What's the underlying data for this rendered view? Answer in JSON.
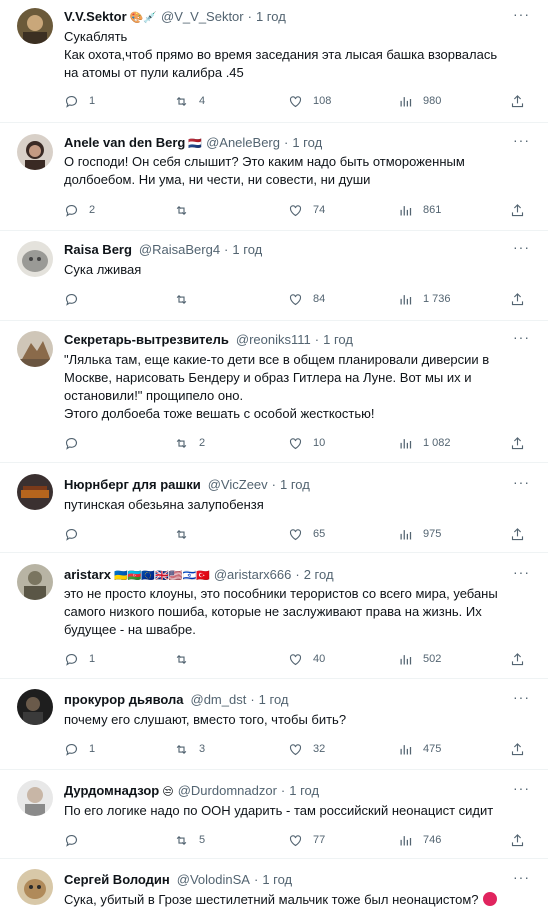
{
  "colors": {
    "text": "#0f1419",
    "secondary": "#536471",
    "divider": "#eff3f4"
  },
  "tweets": [
    {
      "name": "V.V.Sektor",
      "badges": "🎨💉",
      "handle": "@V_V_Sektor",
      "time": "1 год",
      "text": "Сукаблять\nКак охота,чтоб прямо во время заседания эта лысая башка взорвалась\nна  атомы от пули калибра .45",
      "replies": "1",
      "retweets": "4",
      "likes": "108",
      "views": "980",
      "avatar_color": "#6b5a3a"
    },
    {
      "name": "Anele van den Berg",
      "badges": "🇳🇱",
      "handle": "@AneleBerg",
      "time": "1 год",
      "text": "О господи! Он себя слышит? Это каким надо быть отмороженным\nдолбоебом. Ни ума, ни чести, ни совести, ни души",
      "replies": "2",
      "retweets": "",
      "likes": "74",
      "views": "861",
      "avatar_color": "#3a2a24"
    },
    {
      "name": "Raisa Berg",
      "badges": "",
      "handle": "@RaisaBerg4",
      "time": "1 год",
      "text": "Сука лживая",
      "replies": "",
      "retweets": "",
      "likes": "84",
      "views": "1 736",
      "avatar_color": "#9a9a96"
    },
    {
      "name": "Секретарь-вытрезвитель",
      "badges": "",
      "handle": "@reoniks111",
      "time": "1 год",
      "text": "\"Лялька там, еще какие-то дети все в общем планировали диверсии в\nМоскве, нарисовать Бендеру и образ Гитлера на Луне. Вот мы их и\nостановили!\" прощипело оно.\nЭтого долбоеба тоже вешать с особой жесткостью!",
      "replies": "",
      "retweets": "2",
      "likes": "10",
      "views": "1 082",
      "avatar_color": "#8a6a4a"
    },
    {
      "name": "Нюрнберг для рашки",
      "badges": "",
      "handle": "@VicZeev",
      "time": "1 год",
      "text": "путинская обезьяна залупобензя",
      "replies": "",
      "retweets": "",
      "likes": "65",
      "views": "975",
      "avatar_color": "#3a3030"
    },
    {
      "name": "aristarx",
      "badges": "🇺🇦🇦🇿🇪🇺🇬🇧🇺🇸🇮🇱🇹🇷",
      "handle": "@aristarx666",
      "time": "2 год",
      "text": "это не просто клоуны, это пособники терористов со всего мира, уебаны\nсамого низкого пошиба, которые не заслуживают права на жизнь. Их\nбудущее - на швабре.",
      "replies": "1",
      "retweets": "",
      "likes": "40",
      "views": "502",
      "avatar_color": "#7a7560"
    },
    {
      "name": "прокурор дьявола",
      "badges": "",
      "handle": "@dm_dst",
      "time": "1 год",
      "text": "почему его слушают, вместо того, чтобы бить?",
      "replies": "1",
      "retweets": "3",
      "likes": "32",
      "views": "475",
      "avatar_color": "#2a2a2a"
    },
    {
      "name": "Дурдомнадзор",
      "badges": "😒",
      "handle": "@Durdomnadzor",
      "time": "1 год",
      "text": "По его логике надо по ООН ударить - там российский неонацист сидит",
      "replies": "",
      "retweets": "5",
      "likes": "77",
      "views": "746",
      "avatar_color": "#c8c8c8"
    },
    {
      "name": "Сергей Володин",
      "badges": "",
      "handle": "@VolodinSA",
      "time": "1 год",
      "text": "Сука, убитый в Грозе шестилетний мальчик тоже был неонацистом?",
      "replies": "",
      "retweets": "",
      "likes": "",
      "views": "",
      "avatar_color": "#b08a5a"
    }
  ]
}
